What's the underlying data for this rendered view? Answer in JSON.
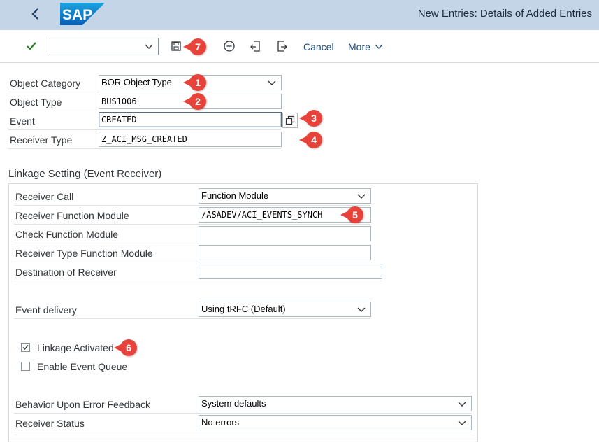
{
  "shell": {
    "title": "New Entries: Details of Added Entries",
    "logo_text": "SAP"
  },
  "toolbar": {
    "command_field_value": "",
    "cancel_label": "Cancel",
    "more_label": "More"
  },
  "callouts": [
    "1",
    "2",
    "3",
    "4",
    "5",
    "6",
    "7"
  ],
  "header_fields": {
    "object_category": {
      "label": "Object Category",
      "value": "BOR Object Type"
    },
    "object_type": {
      "label": "Object Type",
      "value": "BUS1006"
    },
    "event": {
      "label": "Event",
      "value": "CREATED"
    },
    "receiver_type": {
      "label": "Receiver Type",
      "value": "Z_ACI_MSG_CREATED"
    }
  },
  "linkage": {
    "section_title": "Linkage Setting (Event Receiver)",
    "receiver_call": {
      "label": "Receiver Call",
      "value": "Function Module"
    },
    "receiver_function_module": {
      "label": "Receiver Function Module",
      "value": "/ASADEV/ACI_EVENTS_SYNCH"
    },
    "check_function_module": {
      "label": "Check Function Module",
      "value": ""
    },
    "receiver_type_function_module": {
      "label": "Receiver Type Function Module",
      "value": ""
    },
    "destination_of_receiver": {
      "label": "Destination of Receiver",
      "value": ""
    },
    "event_delivery": {
      "label": "Event delivery",
      "value": "Using tRFC (Default)"
    },
    "linkage_activated": {
      "label": "Linkage Activated",
      "checked": true
    },
    "enable_event_queue": {
      "label": "Enable Event Queue",
      "checked": false
    },
    "behavior_upon_error": {
      "label": "Behavior Upon Error Feedback",
      "value": "System defaults"
    },
    "receiver_status": {
      "label": "Receiver Status",
      "value": "No errors"
    }
  },
  "colors": {
    "shell_bg": "#c5d5e8",
    "callout": "#e8433a",
    "check_green": "#2b7d2b",
    "link_blue": "#1a4a7a"
  }
}
